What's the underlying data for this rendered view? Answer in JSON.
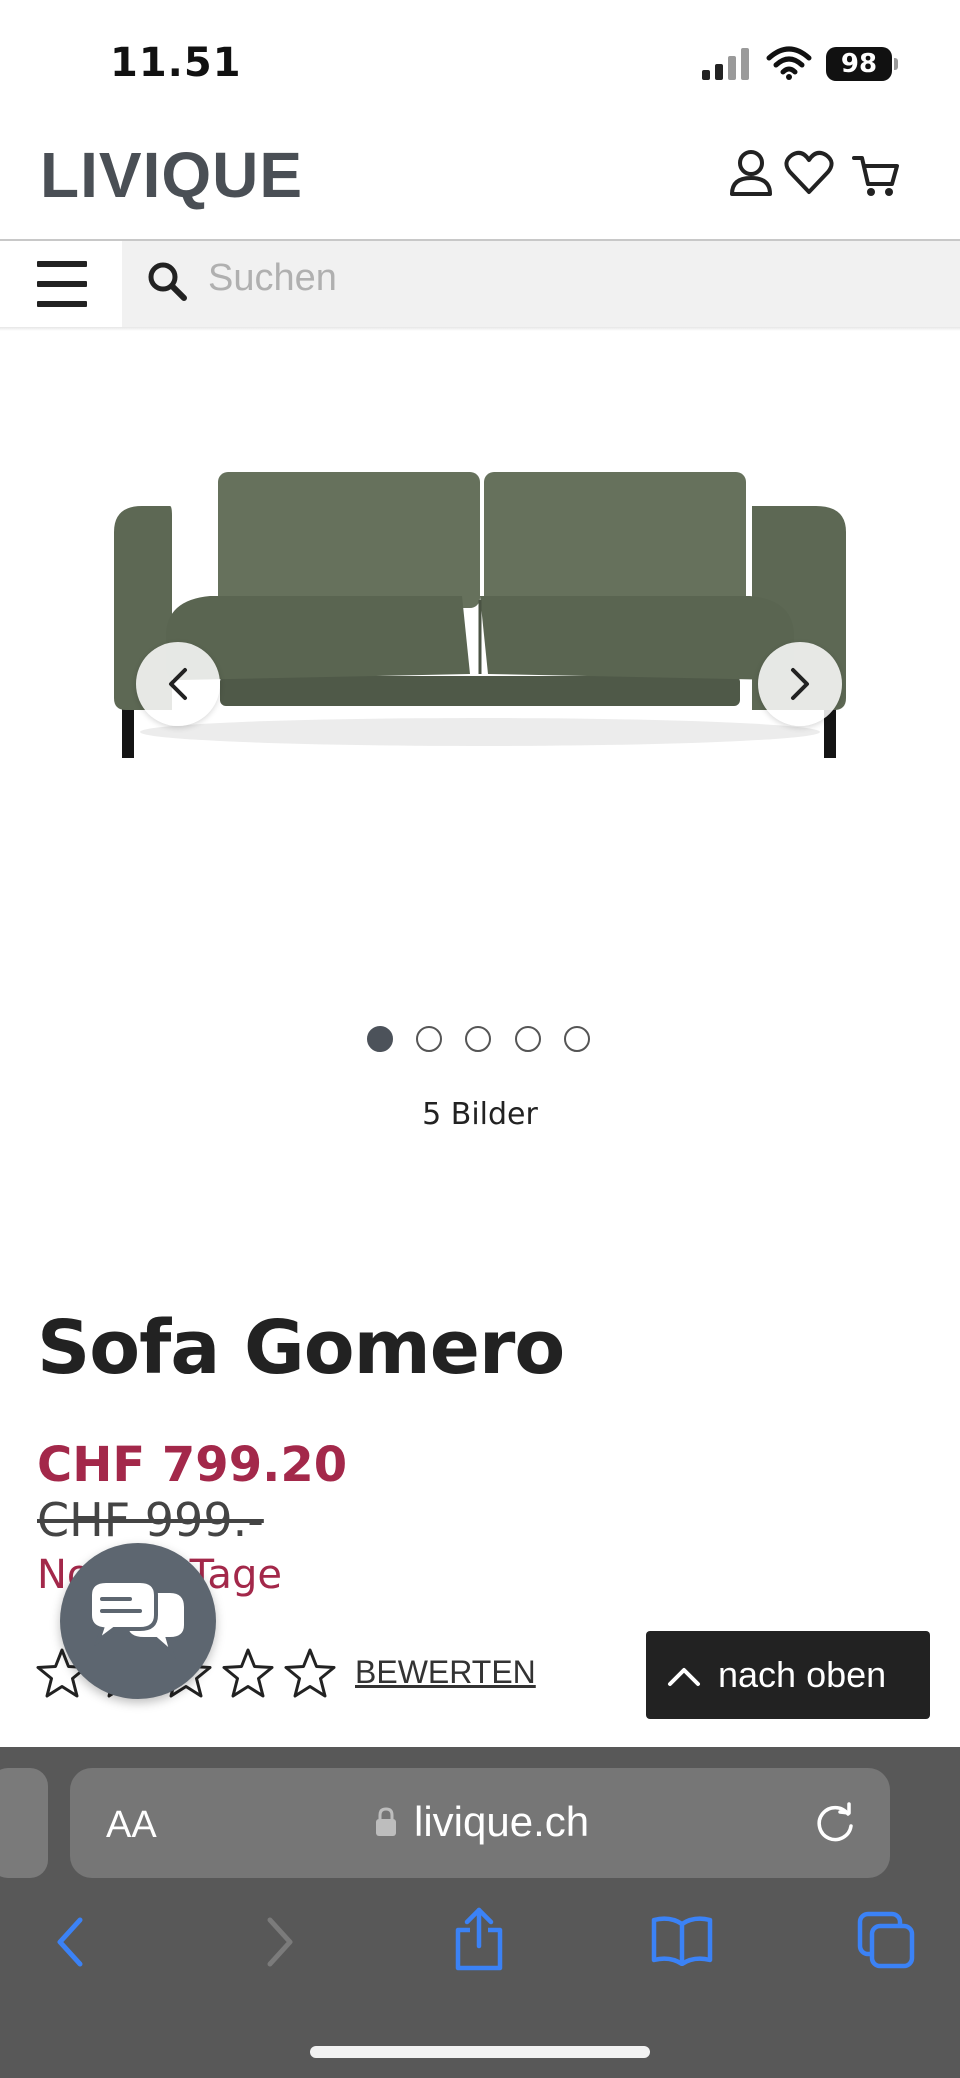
{
  "status_bar": {
    "time": "11.51",
    "battery": "98"
  },
  "header": {
    "logo": "LIVIQUE"
  },
  "search": {
    "placeholder": "Suchen"
  },
  "gallery": {
    "image_count": "5 Bilder",
    "total_images": 5,
    "active_index": 0
  },
  "product": {
    "title": "Sofa Gomero",
    "price_current": "CHF 799.20",
    "price_old": "CHF 999.-",
    "promo_text": "Noch 5 Tage",
    "rating_stars_filled": 0,
    "rating_stars_total": 5,
    "rate_link": "BEWERTEN"
  },
  "to_top": {
    "label": "nach oben"
  },
  "browser": {
    "aa_label": "AA",
    "url": "livique.ch"
  },
  "colors": {
    "accent": "#a3284a",
    "logo": "#4a4f55",
    "sofa": "#5f6a56",
    "browser_bar": "#585858",
    "safari_blue": "#3b82f6"
  }
}
